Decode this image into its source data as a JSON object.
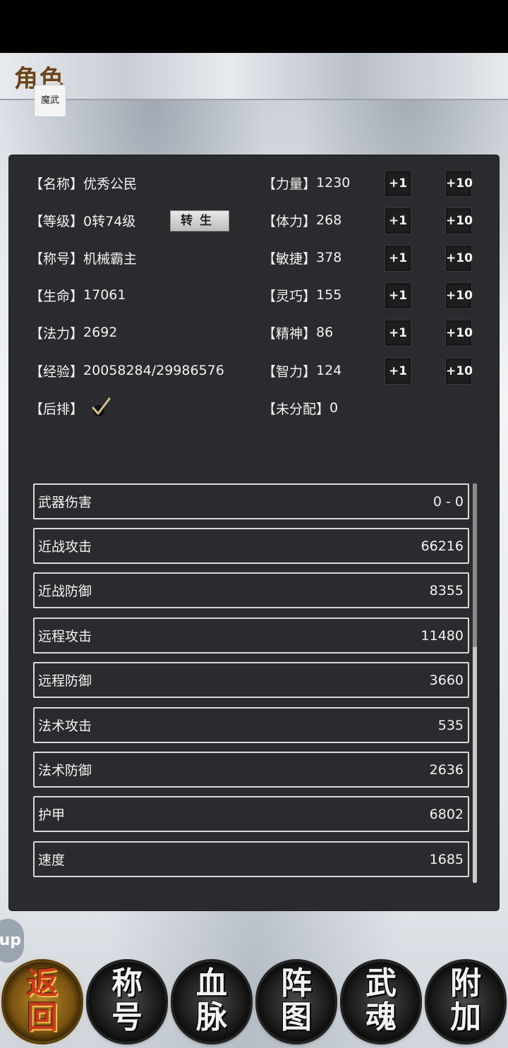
{
  "header": {
    "title": "角色",
    "seal_text": "魔武"
  },
  "info_left": [
    {
      "label": "【名称】",
      "value": "优秀公民"
    },
    {
      "label": "【等级】",
      "value": "0转74级"
    },
    {
      "label": "【称号】",
      "value": "机械霸主"
    },
    {
      "label": "【生命】",
      "value": "17061"
    },
    {
      "label": "【法力】",
      "value": "2692"
    },
    {
      "label": "【经验】",
      "value": "20058284/29986576"
    },
    {
      "label": "【后排】",
      "value": ""
    }
  ],
  "rebirth_button": "转生",
  "attributes": [
    {
      "label": "【力量】",
      "value": "1230"
    },
    {
      "label": "【体力】",
      "value": "268"
    },
    {
      "label": "【敏捷】",
      "value": "378"
    },
    {
      "label": "【灵巧】",
      "value": "155"
    },
    {
      "label": "【精神】",
      "value": "86"
    },
    {
      "label": "【智力】",
      "value": "124"
    }
  ],
  "unallocated": {
    "label": "【未分配】",
    "value": "0"
  },
  "plus_buttons": {
    "plus1": "+1",
    "plus10": "+10"
  },
  "stats": [
    {
      "label": "武器伤害",
      "value": "0 - 0"
    },
    {
      "label": "近战攻击",
      "value": "66216"
    },
    {
      "label": "近战防御",
      "value": "8355"
    },
    {
      "label": "远程攻击",
      "value": "11480"
    },
    {
      "label": "远程防御",
      "value": "3660"
    },
    {
      "label": "法术攻击",
      "value": "535"
    },
    {
      "label": "法术防御",
      "value": "2636"
    },
    {
      "label": "护甲",
      "value": "6802"
    },
    {
      "label": "速度",
      "value": "1685"
    }
  ],
  "floating_help": "up",
  "bottom_nav": [
    {
      "top": "返",
      "bottom": "回"
    },
    {
      "top": "称",
      "bottom": "号"
    },
    {
      "top": "血",
      "bottom": "脉"
    },
    {
      "top": "阵",
      "bottom": "图"
    },
    {
      "top": "武",
      "bottom": "魂"
    },
    {
      "top": "附",
      "bottom": "加"
    }
  ],
  "colors": {
    "panel": "#2a2b2e",
    "title": "#6a4520",
    "active_nav": "#b8892c"
  }
}
